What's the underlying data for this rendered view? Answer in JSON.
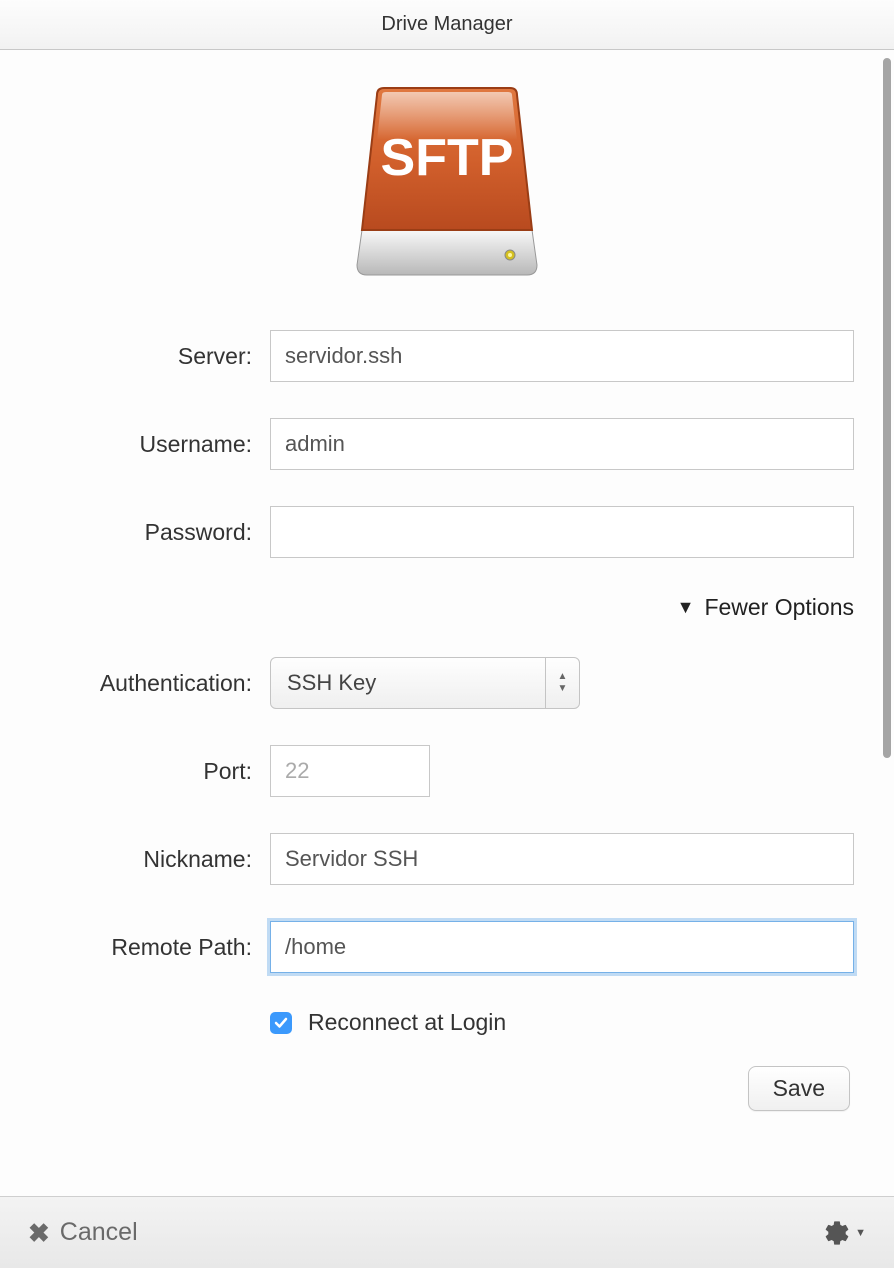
{
  "window": {
    "title": "Drive Manager"
  },
  "drive": {
    "protocol_label": "SFTP"
  },
  "form": {
    "server": {
      "label": "Server:",
      "value": "servidor.ssh"
    },
    "username": {
      "label": "Username:",
      "value": "admin"
    },
    "password": {
      "label": "Password:",
      "value": ""
    },
    "toggle_label": "Fewer Options",
    "authentication": {
      "label": "Authentication:",
      "value": "SSH Key"
    },
    "port": {
      "label": "Port:",
      "value": "22"
    },
    "nickname": {
      "label": "Nickname:",
      "value": "Servidor SSH"
    },
    "remote_path": {
      "label": "Remote Path:",
      "value": "/home"
    },
    "reconnect": {
      "label": "Reconnect at Login",
      "checked": true
    },
    "save_label": "Save"
  },
  "footer": {
    "cancel_label": "Cancel"
  }
}
